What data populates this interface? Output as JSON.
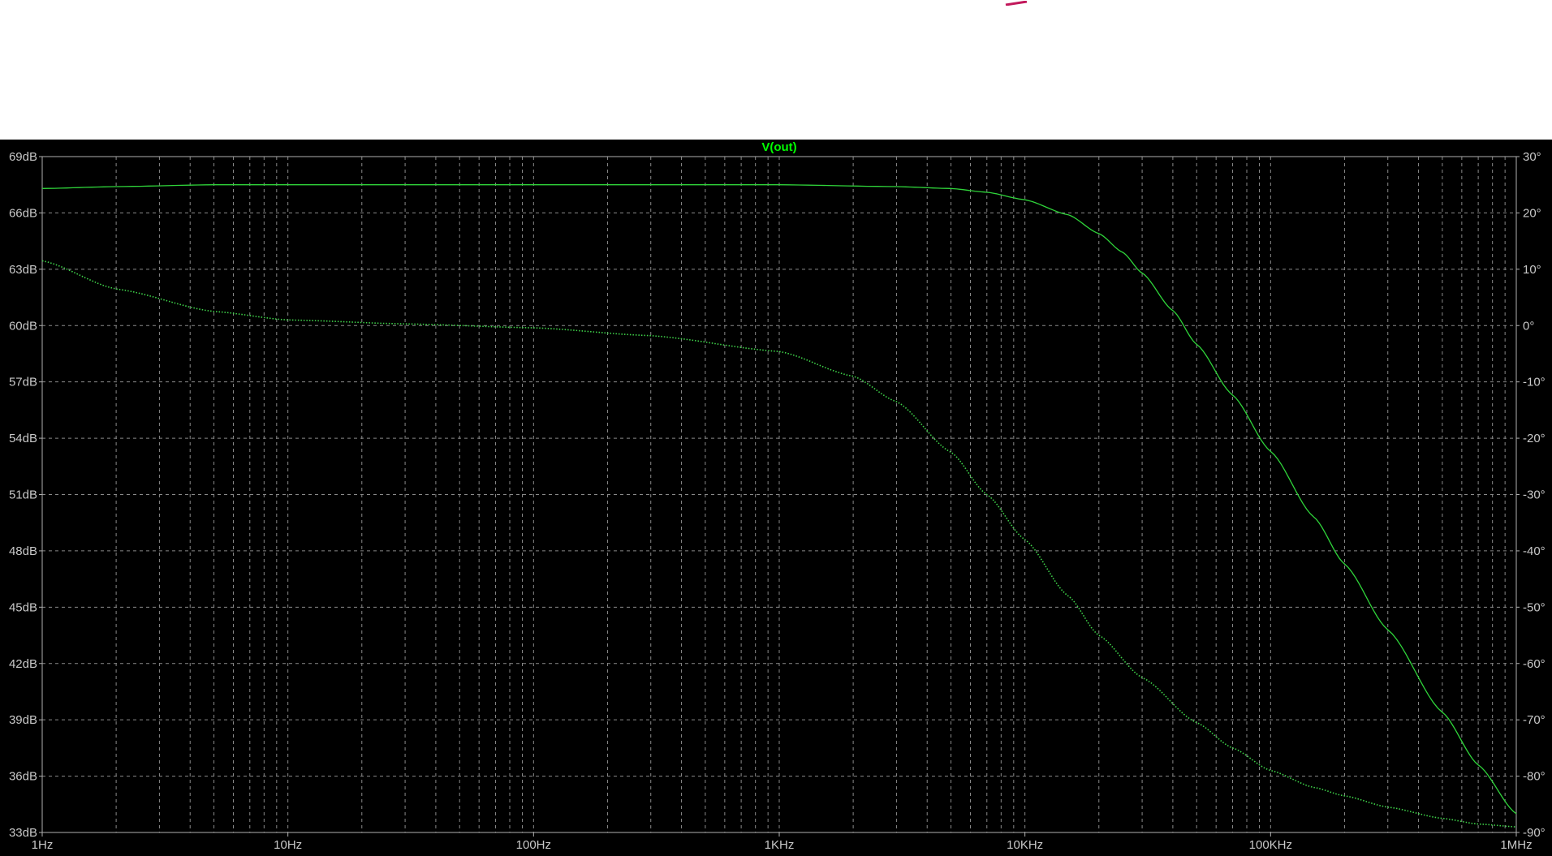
{
  "colors": {
    "background": "#000000",
    "grid": "#8a8a8a",
    "trace": "#2fd43a",
    "phase": "#3fd44a",
    "title": "#00ff00",
    "labels": "#c8c8c8",
    "mark": "#c2185b"
  },
  "chart_data": {
    "type": "line",
    "title": "V(out)",
    "x_scale": "log",
    "xlim": [
      1,
      1000000
    ],
    "x_ticks": [
      {
        "value": 1,
        "label": "1Hz"
      },
      {
        "value": 10,
        "label": "10Hz"
      },
      {
        "value": 100,
        "label": "100Hz"
      },
      {
        "value": 1000,
        "label": "1KHz"
      },
      {
        "value": 10000,
        "label": "10KHz"
      },
      {
        "value": 100000,
        "label": "100KHz"
      },
      {
        "value": 1000000,
        "label": "1MHz"
      }
    ],
    "ylim_left": [
      33,
      69
    ],
    "y_ticks_left": [
      "69dB",
      "66dB",
      "63dB",
      "60dB",
      "57dB",
      "54dB",
      "51dB",
      "48dB",
      "45dB",
      "42dB",
      "39dB",
      "36dB",
      "33dB"
    ],
    "ylim_right": [
      -90,
      30
    ],
    "y_ticks_right": [
      "30°",
      "20°",
      "10°",
      "0°",
      "-10°",
      "-20°",
      "-30°",
      "-40°",
      "-50°",
      "-60°",
      "-70°",
      "-80°",
      "-90°"
    ],
    "grid": true,
    "series": [
      {
        "axis": "left",
        "style": "solid",
        "x": [
          1,
          2,
          5,
          10,
          100,
          1000,
          3000,
          5000,
          7000,
          10000,
          15000,
          20000,
          25000,
          30000,
          40000,
          50000,
          70000,
          100000,
          150000,
          200000,
          300000,
          500000,
          700000,
          1000000
        ],
        "y": [
          67.3,
          67.4,
          67.5,
          67.5,
          67.5,
          67.5,
          67.4,
          67.3,
          67.1,
          66.7,
          65.9,
          64.9,
          63.9,
          62.8,
          60.8,
          59.0,
          56.3,
          53.3,
          49.8,
          47.3,
          43.8,
          39.4,
          36.6,
          34.0
        ]
      },
      {
        "axis": "right",
        "style": "dotted",
        "x": [
          1,
          2,
          5,
          10,
          30,
          100,
          300,
          1000,
          2000,
          3000,
          5000,
          7000,
          10000,
          15000,
          20000,
          30000,
          50000,
          70000,
          100000,
          150000,
          200000,
          300000,
          500000,
          700000,
          1000000
        ],
        "y": [
          11.5,
          6.5,
          2.5,
          1.0,
          0.3,
          -0.4,
          -1.8,
          -4.6,
          -9.0,
          -13.5,
          -22.5,
          -30.0,
          -38.0,
          -48.0,
          -55.0,
          -62.5,
          -70.5,
          -75.0,
          -79.0,
          -82.0,
          -83.5,
          -85.5,
          -87.5,
          -88.5,
          -89.0
        ]
      }
    ]
  }
}
